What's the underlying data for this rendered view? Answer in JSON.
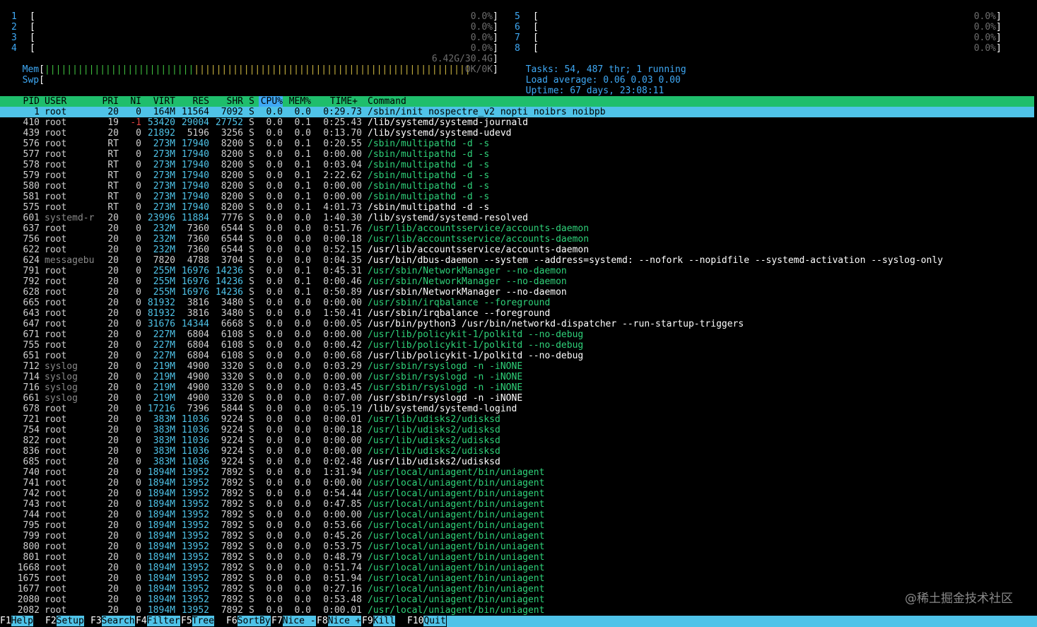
{
  "cpu_meters_left": [
    {
      "id": "1",
      "value": "0.0%"
    },
    {
      "id": "2",
      "value": "0.0%"
    },
    {
      "id": "3",
      "value": "0.0%"
    },
    {
      "id": "4",
      "value": "0.0%"
    }
  ],
  "cpu_meters_right": [
    {
      "id": "5",
      "value": "0.0%"
    },
    {
      "id": "6",
      "value": "0.0%"
    },
    {
      "id": "7",
      "value": "0.0%"
    },
    {
      "id": "8",
      "value": "0.0%"
    }
  ],
  "mem": {
    "label": "Mem",
    "value": "6.42G/30.4G",
    "used_fraction": 0.21
  },
  "swp": {
    "label": "Swp",
    "value": "0K/0K",
    "used_fraction": 0
  },
  "tasks": {
    "label": "Tasks:",
    "text": "54, 487 thr; 1 running"
  },
  "load": {
    "label": "Load average:",
    "text": "0.06 0.03 0.00"
  },
  "uptime": {
    "label": "Uptime:",
    "text": "67 days, 23:08:11"
  },
  "columns": {
    "pid": "PID",
    "user": "USER",
    "pri": "PRI",
    "ni": "NI",
    "virt": "VIRT",
    "res": "RES",
    "shr": "SHR",
    "s": "S",
    "cpu": "CPU%",
    "mem": "MEM%",
    "time": "TIME+",
    "cmd": "Command"
  },
  "processes": [
    {
      "pid": "1",
      "user": "root",
      "pri": "20",
      "ni": "0",
      "virt": "164M",
      "res": "11564",
      "shr": "7092",
      "s": "S",
      "cpu": "0.0",
      "mem": "0.0",
      "time": "0:29.73",
      "cmd": "/sbin/init nospectre_v2 nopti noibrs noibpb",
      "thread": false,
      "selected": true
    },
    {
      "pid": "410",
      "user": "root",
      "pri": "19",
      "ni": "-1",
      "virt": "53420",
      "res": "29004",
      "shr": "27752",
      "s": "S",
      "cpu": "0.0",
      "mem": "0.1",
      "time": "0:25.43",
      "cmd": "/lib/systemd/systemd-journald",
      "thread": false
    },
    {
      "pid": "439",
      "user": "root",
      "pri": "20",
      "ni": "0",
      "virt": "21892",
      "res": "5196",
      "shr": "3256",
      "s": "S",
      "cpu": "0.0",
      "mem": "0.0",
      "time": "0:13.70",
      "cmd": "/lib/systemd/systemd-udevd",
      "thread": false
    },
    {
      "pid": "576",
      "user": "root",
      "pri": "RT",
      "ni": "0",
      "virt": "273M",
      "res": "17940",
      "shr": "8200",
      "s": "S",
      "cpu": "0.0",
      "mem": "0.1",
      "time": "0:20.55",
      "cmd": "/sbin/multipathd -d -s",
      "thread": true
    },
    {
      "pid": "577",
      "user": "root",
      "pri": "RT",
      "ni": "0",
      "virt": "273M",
      "res": "17940",
      "shr": "8200",
      "s": "S",
      "cpu": "0.0",
      "mem": "0.1",
      "time": "0:00.00",
      "cmd": "/sbin/multipathd -d -s",
      "thread": true
    },
    {
      "pid": "578",
      "user": "root",
      "pri": "RT",
      "ni": "0",
      "virt": "273M",
      "res": "17940",
      "shr": "8200",
      "s": "S",
      "cpu": "0.0",
      "mem": "0.1",
      "time": "0:03.04",
      "cmd": "/sbin/multipathd -d -s",
      "thread": true
    },
    {
      "pid": "579",
      "user": "root",
      "pri": "RT",
      "ni": "0",
      "virt": "273M",
      "res": "17940",
      "shr": "8200",
      "s": "S",
      "cpu": "0.0",
      "mem": "0.1",
      "time": "2:22.62",
      "cmd": "/sbin/multipathd -d -s",
      "thread": true
    },
    {
      "pid": "580",
      "user": "root",
      "pri": "RT",
      "ni": "0",
      "virt": "273M",
      "res": "17940",
      "shr": "8200",
      "s": "S",
      "cpu": "0.0",
      "mem": "0.1",
      "time": "0:00.00",
      "cmd": "/sbin/multipathd -d -s",
      "thread": true
    },
    {
      "pid": "581",
      "user": "root",
      "pri": "RT",
      "ni": "0",
      "virt": "273M",
      "res": "17940",
      "shr": "8200",
      "s": "S",
      "cpu": "0.0",
      "mem": "0.1",
      "time": "0:00.00",
      "cmd": "/sbin/multipathd -d -s",
      "thread": true
    },
    {
      "pid": "575",
      "user": "root",
      "pri": "RT",
      "ni": "0",
      "virt": "273M",
      "res": "17940",
      "shr": "8200",
      "s": "S",
      "cpu": "0.0",
      "mem": "0.1",
      "time": "4:01.73",
      "cmd": "/sbin/multipathd -d -s",
      "thread": false
    },
    {
      "pid": "601",
      "user": "systemd-r",
      "pri": "20",
      "ni": "0",
      "virt": "23996",
      "res": "11884",
      "shr": "7776",
      "s": "S",
      "cpu": "0.0",
      "mem": "0.0",
      "time": "1:40.30",
      "cmd": "/lib/systemd/systemd-resolved",
      "thread": false
    },
    {
      "pid": "637",
      "user": "root",
      "pri": "20",
      "ni": "0",
      "virt": "232M",
      "res": "7360",
      "shr": "6544",
      "s": "S",
      "cpu": "0.0",
      "mem": "0.0",
      "time": "0:51.76",
      "cmd": "/usr/lib/accountsservice/accounts-daemon",
      "thread": true
    },
    {
      "pid": "756",
      "user": "root",
      "pri": "20",
      "ni": "0",
      "virt": "232M",
      "res": "7360",
      "shr": "6544",
      "s": "S",
      "cpu": "0.0",
      "mem": "0.0",
      "time": "0:00.18",
      "cmd": "/usr/lib/accountsservice/accounts-daemon",
      "thread": true
    },
    {
      "pid": "622",
      "user": "root",
      "pri": "20",
      "ni": "0",
      "virt": "232M",
      "res": "7360",
      "shr": "6544",
      "s": "S",
      "cpu": "0.0",
      "mem": "0.0",
      "time": "0:52.15",
      "cmd": "/usr/lib/accountsservice/accounts-daemon",
      "thread": false
    },
    {
      "pid": "624",
      "user": "messagebu",
      "pri": "20",
      "ni": "0",
      "virt": "7820",
      "res": "4788",
      "shr": "3704",
      "s": "S",
      "cpu": "0.0",
      "mem": "0.0",
      "time": "0:04.35",
      "cmd": "/usr/bin/dbus-daemon --system --address=systemd: --nofork --nopidfile --systemd-activation --syslog-only",
      "thread": false
    },
    {
      "pid": "791",
      "user": "root",
      "pri": "20",
      "ni": "0",
      "virt": "255M",
      "res": "16976",
      "shr": "14236",
      "s": "S",
      "cpu": "0.0",
      "mem": "0.1",
      "time": "0:45.31",
      "cmd": "/usr/sbin/NetworkManager --no-daemon",
      "thread": true
    },
    {
      "pid": "792",
      "user": "root",
      "pri": "20",
      "ni": "0",
      "virt": "255M",
      "res": "16976",
      "shr": "14236",
      "s": "S",
      "cpu": "0.0",
      "mem": "0.1",
      "time": "0:00.46",
      "cmd": "/usr/sbin/NetworkManager --no-daemon",
      "thread": true
    },
    {
      "pid": "628",
      "user": "root",
      "pri": "20",
      "ni": "0",
      "virt": "255M",
      "res": "16976",
      "shr": "14236",
      "s": "S",
      "cpu": "0.0",
      "mem": "0.1",
      "time": "0:50.89",
      "cmd": "/usr/sbin/NetworkManager --no-daemon",
      "thread": false
    },
    {
      "pid": "665",
      "user": "root",
      "pri": "20",
      "ni": "0",
      "virt": "81932",
      "res": "3816",
      "shr": "3480",
      "s": "S",
      "cpu": "0.0",
      "mem": "0.0",
      "time": "0:00.00",
      "cmd": "/usr/sbin/irqbalance --foreground",
      "thread": true
    },
    {
      "pid": "643",
      "user": "root",
      "pri": "20",
      "ni": "0",
      "virt": "81932",
      "res": "3816",
      "shr": "3480",
      "s": "S",
      "cpu": "0.0",
      "mem": "0.0",
      "time": "1:50.41",
      "cmd": "/usr/sbin/irqbalance --foreground",
      "thread": false
    },
    {
      "pid": "647",
      "user": "root",
      "pri": "20",
      "ni": "0",
      "virt": "31676",
      "res": "14344",
      "shr": "6668",
      "s": "S",
      "cpu": "0.0",
      "mem": "0.0",
      "time": "0:00.05",
      "cmd": "/usr/bin/python3 /usr/bin/networkd-dispatcher --run-startup-triggers",
      "thread": false
    },
    {
      "pid": "671",
      "user": "root",
      "pri": "20",
      "ni": "0",
      "virt": "227M",
      "res": "6804",
      "shr": "6108",
      "s": "S",
      "cpu": "0.0",
      "mem": "0.0",
      "time": "0:00.00",
      "cmd": "/usr/lib/policykit-1/polkitd --no-debug",
      "thread": true
    },
    {
      "pid": "755",
      "user": "root",
      "pri": "20",
      "ni": "0",
      "virt": "227M",
      "res": "6804",
      "shr": "6108",
      "s": "S",
      "cpu": "0.0",
      "mem": "0.0",
      "time": "0:00.42",
      "cmd": "/usr/lib/policykit-1/polkitd --no-debug",
      "thread": true
    },
    {
      "pid": "651",
      "user": "root",
      "pri": "20",
      "ni": "0",
      "virt": "227M",
      "res": "6804",
      "shr": "6108",
      "s": "S",
      "cpu": "0.0",
      "mem": "0.0",
      "time": "0:00.68",
      "cmd": "/usr/lib/policykit-1/polkitd --no-debug",
      "thread": false
    },
    {
      "pid": "712",
      "user": "syslog",
      "pri": "20",
      "ni": "0",
      "virt": "219M",
      "res": "4900",
      "shr": "3320",
      "s": "S",
      "cpu": "0.0",
      "mem": "0.0",
      "time": "0:03.29",
      "cmd": "/usr/sbin/rsyslogd -n -iNONE",
      "thread": true
    },
    {
      "pid": "714",
      "user": "syslog",
      "pri": "20",
      "ni": "0",
      "virt": "219M",
      "res": "4900",
      "shr": "3320",
      "s": "S",
      "cpu": "0.0",
      "mem": "0.0",
      "time": "0:00.00",
      "cmd": "/usr/sbin/rsyslogd -n -iNONE",
      "thread": true
    },
    {
      "pid": "716",
      "user": "syslog",
      "pri": "20",
      "ni": "0",
      "virt": "219M",
      "res": "4900",
      "shr": "3320",
      "s": "S",
      "cpu": "0.0",
      "mem": "0.0",
      "time": "0:03.45",
      "cmd": "/usr/sbin/rsyslogd -n -iNONE",
      "thread": true
    },
    {
      "pid": "661",
      "user": "syslog",
      "pri": "20",
      "ni": "0",
      "virt": "219M",
      "res": "4900",
      "shr": "3320",
      "s": "S",
      "cpu": "0.0",
      "mem": "0.0",
      "time": "0:07.00",
      "cmd": "/usr/sbin/rsyslogd -n -iNONE",
      "thread": false
    },
    {
      "pid": "678",
      "user": "root",
      "pri": "20",
      "ni": "0",
      "virt": "17216",
      "res": "7396",
      "shr": "5844",
      "s": "S",
      "cpu": "0.0",
      "mem": "0.0",
      "time": "0:05.19",
      "cmd": "/lib/systemd/systemd-logind",
      "thread": false
    },
    {
      "pid": "721",
      "user": "root",
      "pri": "20",
      "ni": "0",
      "virt": "383M",
      "res": "11036",
      "shr": "9224",
      "s": "S",
      "cpu": "0.0",
      "mem": "0.0",
      "time": "0:00.01",
      "cmd": "/usr/lib/udisks2/udisksd",
      "thread": true
    },
    {
      "pid": "754",
      "user": "root",
      "pri": "20",
      "ni": "0",
      "virt": "383M",
      "res": "11036",
      "shr": "9224",
      "s": "S",
      "cpu": "0.0",
      "mem": "0.0",
      "time": "0:00.18",
      "cmd": "/usr/lib/udisks2/udisksd",
      "thread": true
    },
    {
      "pid": "822",
      "user": "root",
      "pri": "20",
      "ni": "0",
      "virt": "383M",
      "res": "11036",
      "shr": "9224",
      "s": "S",
      "cpu": "0.0",
      "mem": "0.0",
      "time": "0:00.00",
      "cmd": "/usr/lib/udisks2/udisksd",
      "thread": true
    },
    {
      "pid": "836",
      "user": "root",
      "pri": "20",
      "ni": "0",
      "virt": "383M",
      "res": "11036",
      "shr": "9224",
      "s": "S",
      "cpu": "0.0",
      "mem": "0.0",
      "time": "0:00.00",
      "cmd": "/usr/lib/udisks2/udisksd",
      "thread": true
    },
    {
      "pid": "685",
      "user": "root",
      "pri": "20",
      "ni": "0",
      "virt": "383M",
      "res": "11036",
      "shr": "9224",
      "s": "S",
      "cpu": "0.0",
      "mem": "0.0",
      "time": "0:02.48",
      "cmd": "/usr/lib/udisks2/udisksd",
      "thread": false
    },
    {
      "pid": "740",
      "user": "root",
      "pri": "20",
      "ni": "0",
      "virt": "1894M",
      "res": "13952",
      "shr": "7892",
      "s": "S",
      "cpu": "0.0",
      "mem": "0.0",
      "time": "1:31.94",
      "cmd": "/usr/local/uniagent/bin/uniagent",
      "thread": true
    },
    {
      "pid": "741",
      "user": "root",
      "pri": "20",
      "ni": "0",
      "virt": "1894M",
      "res": "13952",
      "shr": "7892",
      "s": "S",
      "cpu": "0.0",
      "mem": "0.0",
      "time": "0:00.00",
      "cmd": "/usr/local/uniagent/bin/uniagent",
      "thread": true
    },
    {
      "pid": "742",
      "user": "root",
      "pri": "20",
      "ni": "0",
      "virt": "1894M",
      "res": "13952",
      "shr": "7892",
      "s": "S",
      "cpu": "0.0",
      "mem": "0.0",
      "time": "0:54.44",
      "cmd": "/usr/local/uniagent/bin/uniagent",
      "thread": true
    },
    {
      "pid": "743",
      "user": "root",
      "pri": "20",
      "ni": "0",
      "virt": "1894M",
      "res": "13952",
      "shr": "7892",
      "s": "S",
      "cpu": "0.0",
      "mem": "0.0",
      "time": "0:47.85",
      "cmd": "/usr/local/uniagent/bin/uniagent",
      "thread": true
    },
    {
      "pid": "744",
      "user": "root",
      "pri": "20",
      "ni": "0",
      "virt": "1894M",
      "res": "13952",
      "shr": "7892",
      "s": "S",
      "cpu": "0.0",
      "mem": "0.0",
      "time": "0:00.00",
      "cmd": "/usr/local/uniagent/bin/uniagent",
      "thread": true
    },
    {
      "pid": "795",
      "user": "root",
      "pri": "20",
      "ni": "0",
      "virt": "1894M",
      "res": "13952",
      "shr": "7892",
      "s": "S",
      "cpu": "0.0",
      "mem": "0.0",
      "time": "0:53.66",
      "cmd": "/usr/local/uniagent/bin/uniagent",
      "thread": true
    },
    {
      "pid": "799",
      "user": "root",
      "pri": "20",
      "ni": "0",
      "virt": "1894M",
      "res": "13952",
      "shr": "7892",
      "s": "S",
      "cpu": "0.0",
      "mem": "0.0",
      "time": "0:45.26",
      "cmd": "/usr/local/uniagent/bin/uniagent",
      "thread": true
    },
    {
      "pid": "800",
      "user": "root",
      "pri": "20",
      "ni": "0",
      "virt": "1894M",
      "res": "13952",
      "shr": "7892",
      "s": "S",
      "cpu": "0.0",
      "mem": "0.0",
      "time": "0:53.75",
      "cmd": "/usr/local/uniagent/bin/uniagent",
      "thread": true
    },
    {
      "pid": "801",
      "user": "root",
      "pri": "20",
      "ni": "0",
      "virt": "1894M",
      "res": "13952",
      "shr": "7892",
      "s": "S",
      "cpu": "0.0",
      "mem": "0.0",
      "time": "0:48.79",
      "cmd": "/usr/local/uniagent/bin/uniagent",
      "thread": true
    },
    {
      "pid": "1668",
      "user": "root",
      "pri": "20",
      "ni": "0",
      "virt": "1894M",
      "res": "13952",
      "shr": "7892",
      "s": "S",
      "cpu": "0.0",
      "mem": "0.0",
      "time": "0:51.74",
      "cmd": "/usr/local/uniagent/bin/uniagent",
      "thread": true
    },
    {
      "pid": "1675",
      "user": "root",
      "pri": "20",
      "ni": "0",
      "virt": "1894M",
      "res": "13952",
      "shr": "7892",
      "s": "S",
      "cpu": "0.0",
      "mem": "0.0",
      "time": "0:51.94",
      "cmd": "/usr/local/uniagent/bin/uniagent",
      "thread": true
    },
    {
      "pid": "1677",
      "user": "root",
      "pri": "20",
      "ni": "0",
      "virt": "1894M",
      "res": "13952",
      "shr": "7892",
      "s": "S",
      "cpu": "0.0",
      "mem": "0.0",
      "time": "0:27.16",
      "cmd": "/usr/local/uniagent/bin/uniagent",
      "thread": true
    },
    {
      "pid": "2080",
      "user": "root",
      "pri": "20",
      "ni": "0",
      "virt": "1894M",
      "res": "13952",
      "shr": "7892",
      "s": "S",
      "cpu": "0.0",
      "mem": "0.0",
      "time": "0:53.48",
      "cmd": "/usr/local/uniagent/bin/uniagent",
      "thread": true
    },
    {
      "pid": "2082",
      "user": "root",
      "pri": "20",
      "ni": "0",
      "virt": "1894M",
      "res": "13952",
      "shr": "7892",
      "s": "S",
      "cpu": "0.0",
      "mem": "0.0",
      "time": "0:00.01",
      "cmd": "/usr/local/uniagent/bin/uniagent",
      "thread": true
    }
  ],
  "fkeys": [
    {
      "key": "F1",
      "label": "Help"
    },
    {
      "key": "F2",
      "label": "Setup"
    },
    {
      "key": "F3",
      "label": "Search"
    },
    {
      "key": "F4",
      "label": "Filter"
    },
    {
      "key": "F5",
      "label": "Tree"
    },
    {
      "key": "F6",
      "label": "SortBy"
    },
    {
      "key": "F7",
      "label": "Nice -"
    },
    {
      "key": "F8",
      "label": "Nice +"
    },
    {
      "key": "F9",
      "label": "Kill"
    },
    {
      "key": "F10",
      "label": "Quit"
    }
  ],
  "watermark": "@稀土掘金技术社区"
}
